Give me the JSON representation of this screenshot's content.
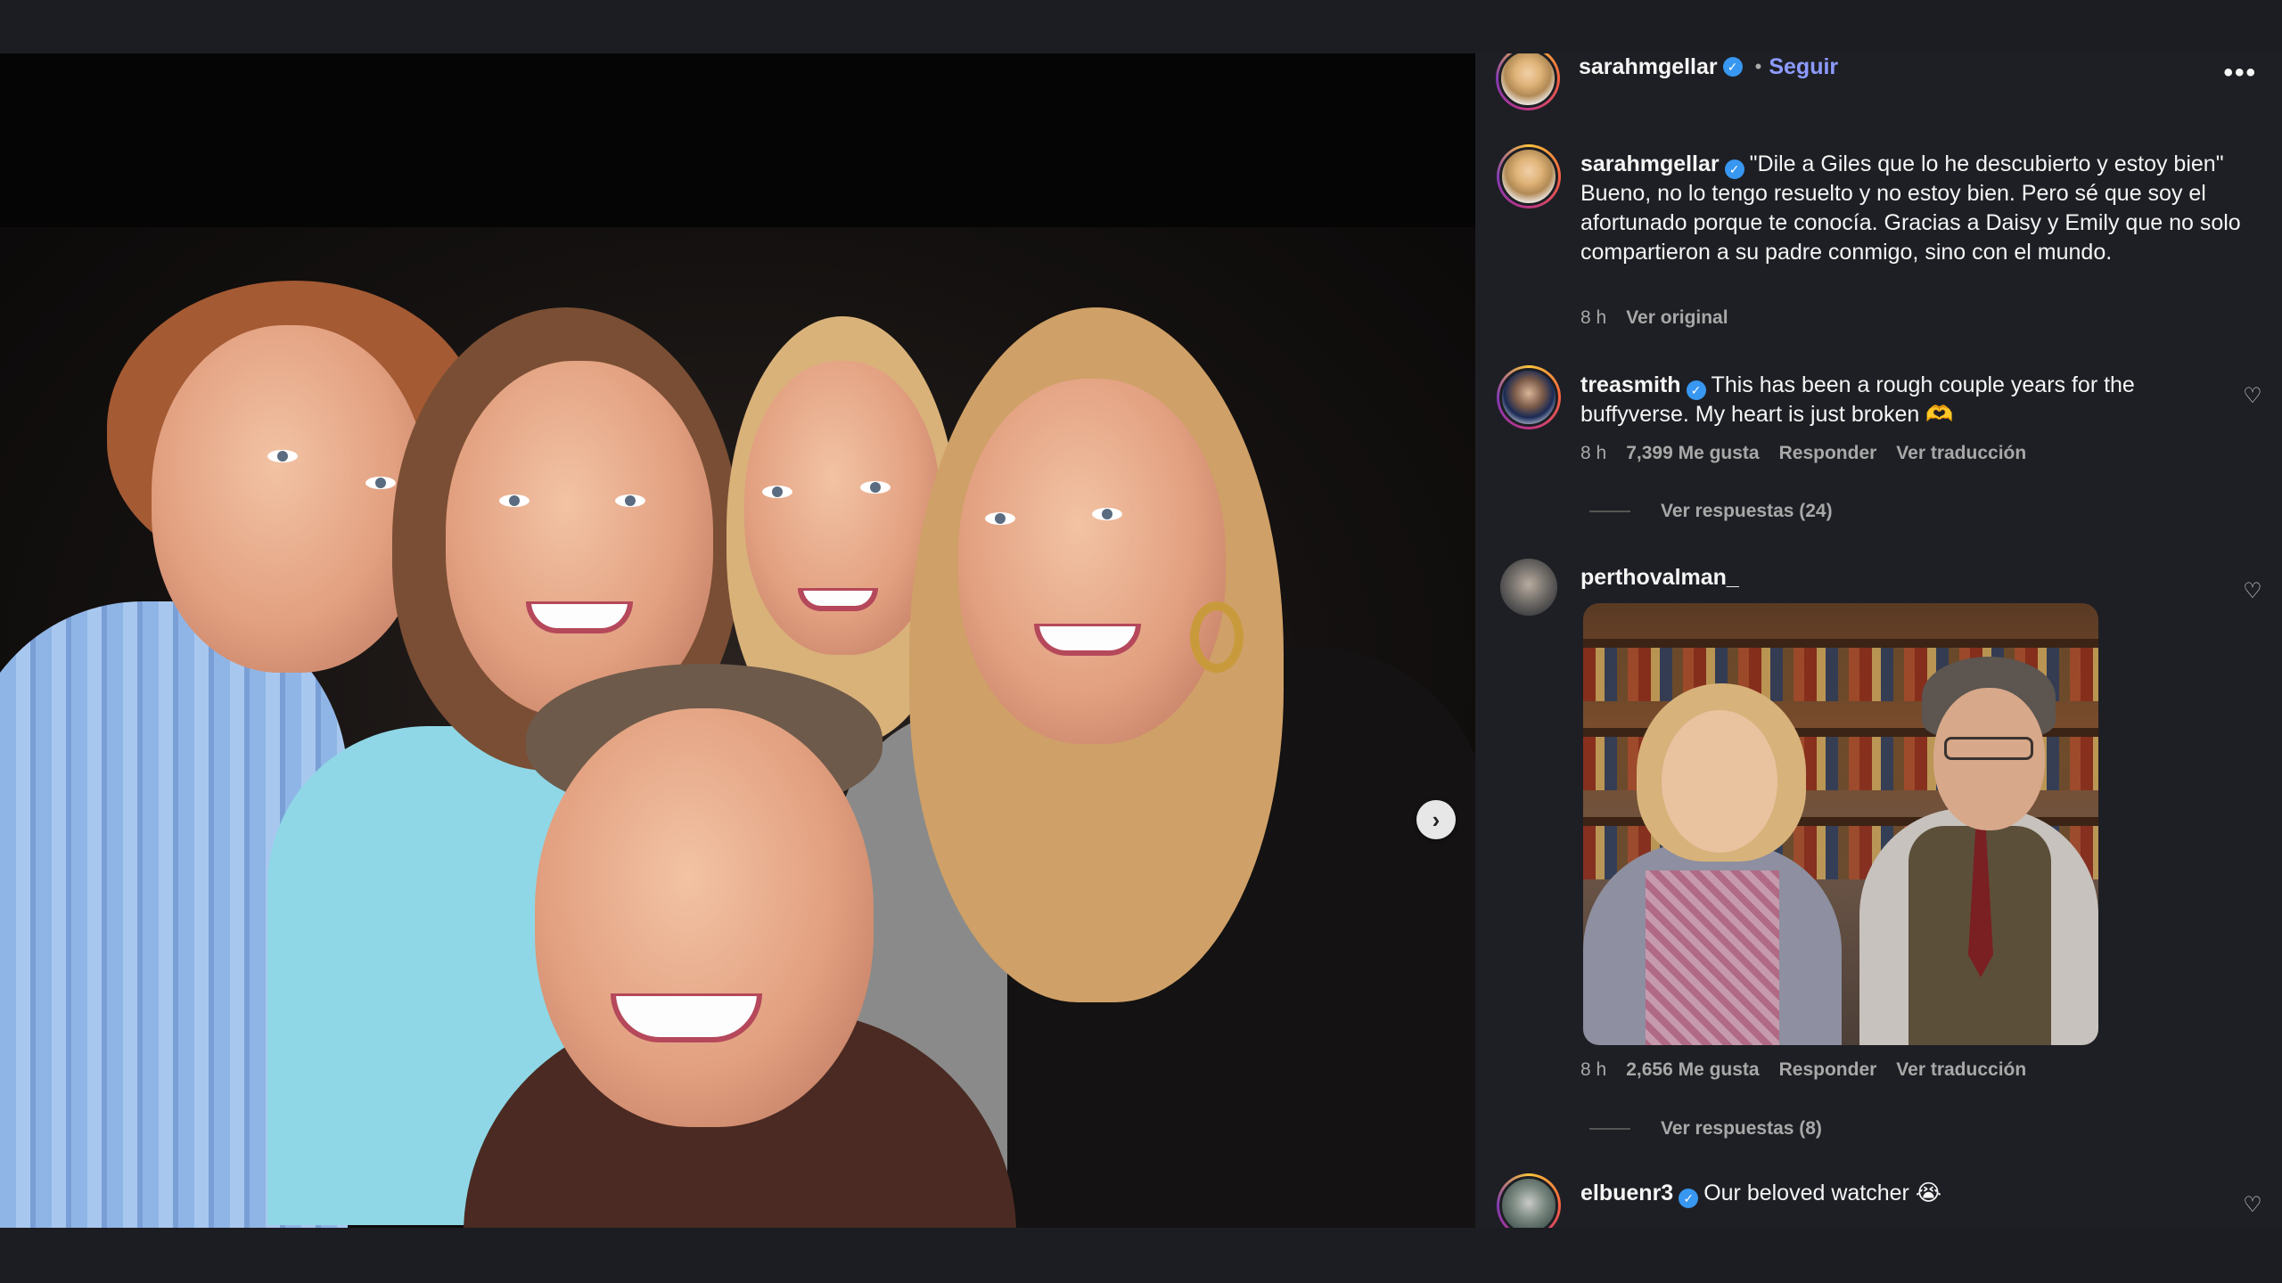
{
  "post": {
    "author": "sarahmgellar",
    "follow_label": "Seguir",
    "separator": "•",
    "more_label": "•••",
    "next_icon": "›"
  },
  "caption": {
    "username": "sarahmgellar",
    "text": "\"Dile a Giles que lo he descubierto y estoy bien\" Bueno, no lo tengo resuelto y no estoy bien. Pero sé que soy el afortunado porque te conocía. Gracias a Daisy y Emily que no solo compartieron a su padre conmigo, sino con el mundo.",
    "time": "8 h",
    "see_original": "Ver original"
  },
  "comments": [
    {
      "username": "treasmith",
      "verified": true,
      "text": "This has been a rough couple years for the buffyverse. My heart is just broken 🫶",
      "time": "8 h",
      "likes": "7,399 Me gusta",
      "reply": "Responder",
      "translate": "Ver traducción",
      "view_replies": "Ver respuestas (24)"
    },
    {
      "username": "perthovalman_",
      "verified": false,
      "time": "8 h",
      "likes": "2,656 Me gusta",
      "reply": "Responder",
      "translate": "Ver traducción",
      "view_replies": "Ver respuestas (8)"
    },
    {
      "username": "elbuenr3",
      "verified": true,
      "text": "Our beloved watcher 😭"
    }
  ],
  "icons": {
    "verified": "verified-badge-icon",
    "heart": "heart-icon",
    "next": "chevron-right-icon",
    "more": "more-options-icon"
  },
  "colors": {
    "follow": "#8c9bff",
    "verified": "#3897f0",
    "panel_bg": "#1e1f24",
    "muted_text": "#a8a8a8"
  }
}
